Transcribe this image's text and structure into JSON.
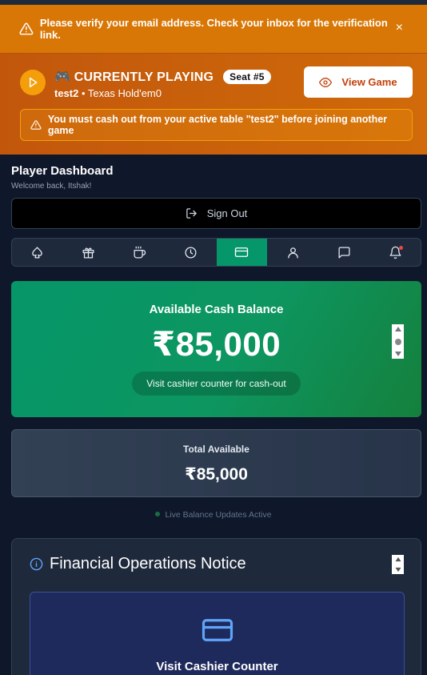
{
  "verify_banner": {
    "message": "Please verify your email address. Check your inbox for the verification link.",
    "close_glyph": "×",
    "bg_color": "#d97706"
  },
  "playing": {
    "title": "🎮 CURRENTLY PLAYING",
    "seat_badge": "Seat #5",
    "table_name": "test2",
    "game_type": " • Texas Hold'em0",
    "view_button": "View Game",
    "cashout_warning": "You must cash out from your active table \"test2\" before joining another game"
  },
  "dashboard": {
    "title": "Player Dashboard",
    "welcome": "Welcome back, Itshak!",
    "sign_out": "Sign Out"
  },
  "tabs": [
    {
      "icon": "spade-icon",
      "active": false
    },
    {
      "icon": "gift-icon",
      "active": false
    },
    {
      "icon": "coffee-icon",
      "active": false
    },
    {
      "icon": "clock-icon",
      "active": false
    },
    {
      "icon": "credit-card-icon",
      "active": true
    },
    {
      "icon": "user-icon",
      "active": false
    },
    {
      "icon": "chat-icon",
      "active": false
    },
    {
      "icon": "bell-icon",
      "active": false,
      "notification": true
    }
  ],
  "cash_card": {
    "label": "Available Cash Balance",
    "amount": "₹85,000",
    "note": "Visit cashier counter for cash-out"
  },
  "total": {
    "label": "Total Available",
    "amount": "₹85,000"
  },
  "live_status": "Live Balance Updates Active",
  "notice": {
    "title": "Financial Operations Notice",
    "cashier_heading": "Visit Cashier Counter"
  },
  "colors": {
    "accent_green": "#059669",
    "warning_orange": "#d97706",
    "background": "#0f172a"
  }
}
